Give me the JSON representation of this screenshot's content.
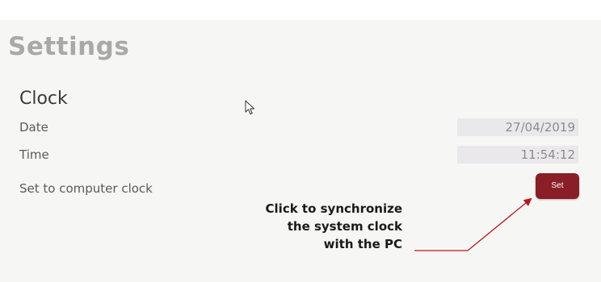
{
  "page": {
    "title": "Settings"
  },
  "clock": {
    "section_title": "Clock",
    "date_label": "Date",
    "date_value": "27/04/2019",
    "time_label": "Time",
    "time_value": "11:54:12",
    "sync_label": "Set to computer clock",
    "set_button_label": "Set"
  },
  "annotation": {
    "line1": "Click to synchronize",
    "line2": "the system clock",
    "line3": "with the PC"
  },
  "colors": {
    "accent": "#8a1e26",
    "annotation_arrow": "#c0141c",
    "title": "#a9a9a9",
    "field_bg": "#ebe8ec"
  },
  "icons": {
    "cursor": "mouse-pointer-icon"
  }
}
